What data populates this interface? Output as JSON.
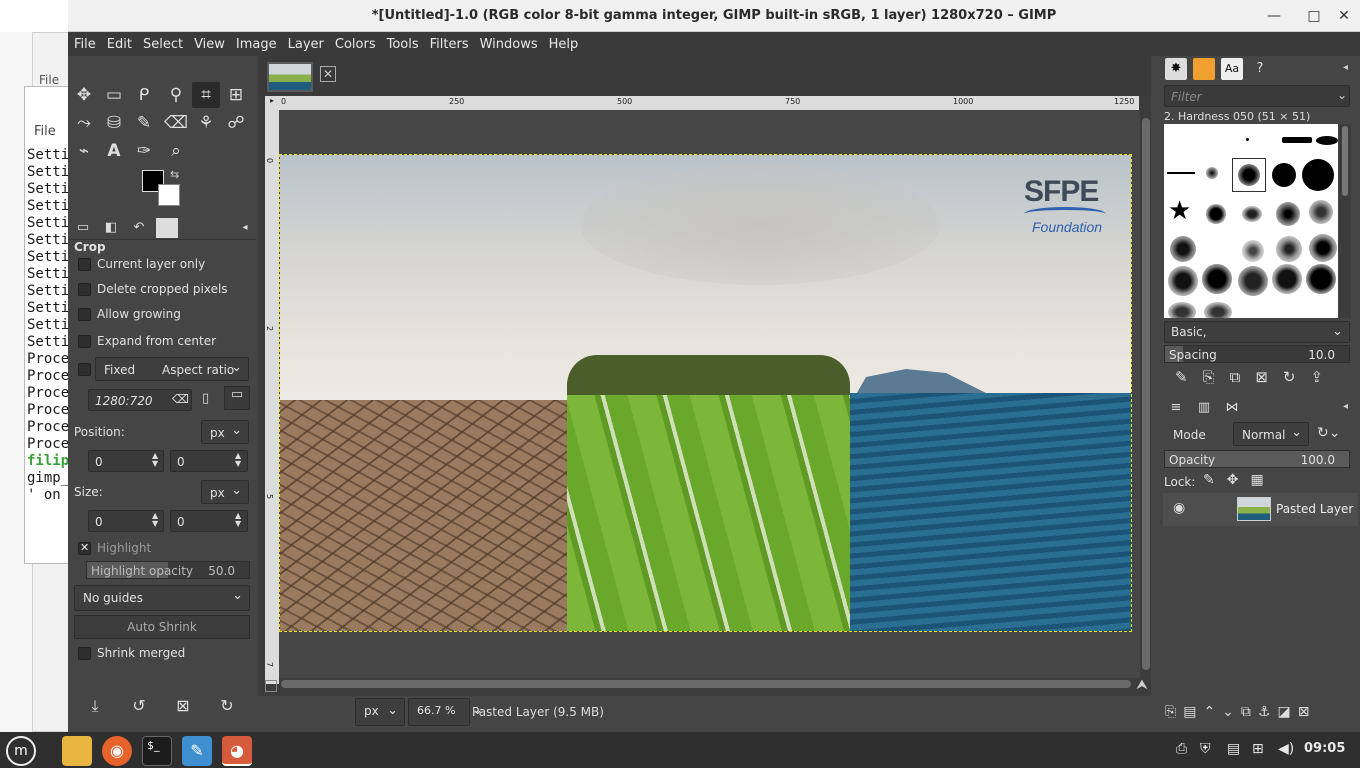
{
  "background_windows": {
    "file_label": "File",
    "terminal_file_label": "File",
    "terminal_lines": [
      "Setti",
      "Setti",
      "Setti",
      "Setti",
      "Setti",
      "Setti",
      "Setti",
      "Setti",
      "Setti",
      "Setti",
      "Setti",
      "Setti",
      "Proce",
      "Proce",
      "Proce",
      "Proce",
      "Proce",
      "Proce",
      "filip",
      "gimp_",
      "' on "
    ]
  },
  "window": {
    "title": "*[Untitled]-1.0 (RGB color 8-bit gamma integer, GIMP built-in sRGB, 1 layer) 1280x720 – GIMP",
    "minimize": "—",
    "maximize": "□",
    "close": "✕"
  },
  "menubar": [
    "File",
    "Edit",
    "Select",
    "View",
    "Image",
    "Layer",
    "Colors",
    "Tools",
    "Filters",
    "Windows",
    "Help"
  ],
  "toolbox": {
    "tools": [
      {
        "icon": "move-icon",
        "glyph": "✥"
      },
      {
        "icon": "rect-select-icon",
        "glyph": "▭"
      },
      {
        "icon": "lasso-icon",
        "glyph": "ᑭ"
      },
      {
        "icon": "fuzzy-select-icon",
        "glyph": "⚲"
      },
      {
        "icon": "crop-icon",
        "glyph": "⌗"
      },
      {
        "icon": "transform-icon",
        "glyph": "⊞"
      },
      {
        "icon": "warp-icon",
        "glyph": "⤳"
      },
      {
        "icon": "bucket-fill-icon",
        "glyph": "⛁"
      },
      {
        "icon": "paintbrush-icon",
        "glyph": "✎"
      },
      {
        "icon": "eraser-icon",
        "glyph": "⌫"
      },
      {
        "icon": "clone-icon",
        "glyph": "⚘"
      },
      {
        "icon": "smudge-icon",
        "glyph": "☍"
      },
      {
        "icon": "path-icon",
        "glyph": "⌁"
      },
      {
        "icon": "text-icon",
        "glyph": "A"
      },
      {
        "icon": "color-picker-icon",
        "glyph": "✑"
      },
      {
        "icon": "zoom-icon",
        "glyph": "⌕"
      }
    ],
    "fg_color": "#000000",
    "bg_color": "#ffffff"
  },
  "tool_options": {
    "title": "Crop",
    "current_layer_only": "Current layer only",
    "delete_cropped": "Delete cropped pixels",
    "allow_growing": "Allow growing",
    "expand_from_center": "Expand from center",
    "fixed_label": "Fixed",
    "fixed_mode": "Aspect ratio",
    "ratio_value": "1280:720",
    "position_label": "Position:",
    "position_unit": "px",
    "position_x": "0",
    "position_y": "0",
    "size_label": "Size:",
    "size_unit": "px",
    "size_w": "0",
    "size_h": "0",
    "highlight_label": "Highlight",
    "highlight_opacity_label": "Highlight opacity",
    "highlight_opacity_value": "50.0",
    "guides": "No guides",
    "auto_shrink": "Auto Shrink",
    "shrink_merged": "Shrink merged"
  },
  "canvas": {
    "ruler_labels": [
      "0",
      "250",
      "500",
      "750",
      "1000",
      "1250"
    ],
    "vruler_labels": [
      "0",
      "2",
      "5",
      "7"
    ],
    "logo_text": "SFPE",
    "logo_sub": "Foundation"
  },
  "statusbar": {
    "unit": "px",
    "zoom": "66.7 %",
    "info": "Pasted Layer (9.5 MB)"
  },
  "right_dock": {
    "filter_placeholder": "Filter",
    "brush_name": "2. Hardness 050 (51 × 51)",
    "preset": "Basic,",
    "spacing_label": "Spacing",
    "spacing_value": "10.0",
    "mode_label": "Mode",
    "mode_value": "Normal",
    "opacity_label": "Opacity",
    "opacity_value": "100.0",
    "lock_label": "Lock:",
    "layer_name": "Pasted Layer"
  },
  "taskbar": {
    "clock": "09:05"
  }
}
